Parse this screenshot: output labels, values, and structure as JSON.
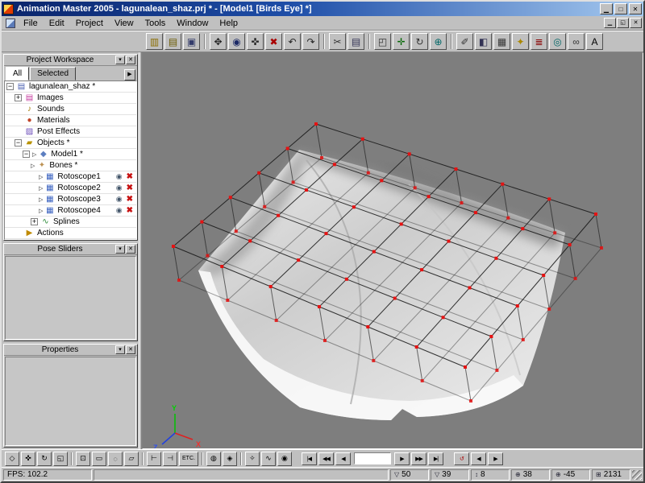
{
  "window": {
    "title": "Animation Master 2005 - lagunalean_shaz.prj * - [Model1 [Birds Eye] *]",
    "controls": [
      {
        "name": "minimize-button",
        "glyph": "▁"
      },
      {
        "name": "maximize-button",
        "glyph": "□"
      },
      {
        "name": "close-button",
        "glyph": "✕"
      }
    ],
    "mdi_controls": [
      {
        "name": "mdi-minimize-button",
        "glyph": "▁"
      },
      {
        "name": "mdi-restore-button",
        "glyph": "◱"
      },
      {
        "name": "mdi-close-button",
        "glyph": "✕"
      }
    ]
  },
  "menus": [
    "File",
    "Edit",
    "Project",
    "View",
    "Tools",
    "Window",
    "Help"
  ],
  "toolbar": {
    "groups": [
      [
        {
          "name": "library-icon",
          "glyph": "▥",
          "color": "#8a6d00"
        },
        {
          "name": "open-project-icon",
          "glyph": "▤",
          "color": "#6b5b00"
        },
        {
          "name": "save-project-icon",
          "glyph": "▣",
          "color": "#343c6b"
        }
      ],
      [
        {
          "name": "pan-icon",
          "glyph": "✥",
          "color": "#222222"
        },
        {
          "name": "zoom-icon",
          "glyph": "◉",
          "color": "#1c2a66"
        },
        {
          "name": "move-icon",
          "glyph": "✜",
          "color": "#222222"
        },
        {
          "name": "delete-icon",
          "glyph": "✖",
          "color": "#aa0000"
        },
        {
          "name": "undo-icon",
          "glyph": "↶",
          "color": "#222222"
        },
        {
          "name": "redo-icon",
          "glyph": "↷",
          "color": "#222222"
        }
      ],
      [
        {
          "name": "cut-icon",
          "glyph": "✂",
          "color": "#333333"
        },
        {
          "name": "copy-icon",
          "glyph": "▤",
          "color": "#333355"
        }
      ],
      [
        {
          "name": "bound-box-icon",
          "glyph": "◰",
          "color": "#333333"
        },
        {
          "name": "translate-manipulator-icon",
          "glyph": "✛",
          "color": "#006600"
        },
        {
          "name": "rotate-manipulator-icon",
          "glyph": "↻",
          "color": "#333333"
        },
        {
          "name": "globe-icon",
          "glyph": "⊕",
          "color": "#006666"
        }
      ],
      [
        {
          "name": "pencil-icon",
          "glyph": "✐",
          "color": "#333333"
        },
        {
          "name": "mirror-mode-icon",
          "glyph": "◧",
          "color": "#333355"
        },
        {
          "name": "grid-icon",
          "glyph": "▦",
          "color": "#333333"
        },
        {
          "name": "key-icon",
          "glyph": "✦",
          "color": "#aa8800"
        },
        {
          "name": "library2-icon",
          "glyph": "≣",
          "color": "#880000"
        },
        {
          "name": "cd-icon",
          "glyph": "◎",
          "color": "#006666"
        },
        {
          "name": "link-icon",
          "glyph": "∞",
          "color": "#333333"
        },
        {
          "name": "font-icon",
          "glyph": "A",
          "color": "#000000"
        }
      ]
    ]
  },
  "workspace": {
    "title": "Project Workspace",
    "header_buttons": [
      {
        "name": "workspace-rollup-button",
        "glyph": "▾"
      },
      {
        "name": "workspace-close-button",
        "glyph": "✕"
      }
    ],
    "tabs": [
      {
        "label": "All",
        "active": true
      },
      {
        "label": "Selected",
        "active": false
      }
    ],
    "tab_scroll": "▶",
    "expander_arrow": "▷",
    "toggle_icons": {
      "eye": "◉",
      "x": "✖"
    },
    "tree_icons": {
      "project": {
        "glyph": "▤",
        "color": "#4a5fb0"
      },
      "images": {
        "glyph": "▤",
        "color": "#c43a9e"
      },
      "sounds": {
        "glyph": "♪",
        "color": "#a07800"
      },
      "materials": {
        "glyph": "●",
        "color": "#c04428"
      },
      "posteffects": {
        "glyph": "▨",
        "color": "#6a4ab8"
      },
      "objects": {
        "glyph": "▰",
        "color": "#b89200"
      },
      "model": {
        "glyph": "◆",
        "color": "#5c7ec0"
      },
      "bones": {
        "glyph": "✦",
        "color": "#bd9355"
      },
      "rotoscope": {
        "glyph": "▦",
        "color": "#3a62c0"
      },
      "splines": {
        "glyph": "∿",
        "color": "#2e8c3a"
      },
      "actions": {
        "glyph": "▶",
        "color": "#c08a00"
      }
    },
    "tree": [
      {
        "label": "lagunalean_shaz *",
        "level": 0,
        "expand": "-",
        "icon": "project"
      },
      {
        "label": "Images",
        "level": 1,
        "expand": "+",
        "icon": "images"
      },
      {
        "label": "Sounds",
        "level": 1,
        "icon": "sounds"
      },
      {
        "label": "Materials",
        "level": 1,
        "icon": "materials"
      },
      {
        "label": "Post Effects",
        "level": 1,
        "icon": "posteffects"
      },
      {
        "label": "Objects *",
        "level": 1,
        "expand": "-",
        "icon": "objects"
      },
      {
        "label": "Model1 *",
        "level": 2,
        "expand": "-",
        "arrow": true,
        "icon": "model"
      },
      {
        "label": "Bones *",
        "level": 3,
        "arrow": true,
        "icon": "bones"
      },
      {
        "label": "Rotoscope1",
        "level": 4,
        "arrow": true,
        "icon": "rotoscope",
        "toggles": true
      },
      {
        "label": "Rotoscope2",
        "level": 4,
        "arrow": true,
        "icon": "rotoscope",
        "toggles": true
      },
      {
        "label": "Rotoscope3",
        "level": 4,
        "arrow": true,
        "icon": "rotoscope",
        "toggles": true
      },
      {
        "label": "Rotoscope4",
        "level": 4,
        "arrow": true,
        "icon": "rotoscope",
        "toggles": true
      },
      {
        "label": "Splines",
        "level": 3,
        "expand": "+",
        "icon": "splines"
      },
      {
        "label": "Actions",
        "level": 1,
        "icon": "actions"
      }
    ]
  },
  "pose_sliders": {
    "title": "Pose Sliders",
    "header_buttons": [
      {
        "name": "pose-rollup-button",
        "glyph": "▾"
      },
      {
        "name": "pose-close-button",
        "glyph": "✕"
      }
    ]
  },
  "properties": {
    "title": "Properties",
    "header_buttons": [
      {
        "name": "properties-rollup-button",
        "glyph": "▾"
      },
      {
        "name": "properties-close-button",
        "glyph": "✕"
      }
    ]
  },
  "viewport": {
    "axis_labels": {
      "x": "X",
      "y": "Y",
      "z": "Z"
    }
  },
  "bottom_toolbar": {
    "groups": [
      [
        {
          "name": "standard-mode-icon",
          "glyph": "◇"
        },
        {
          "name": "translate-mode-icon",
          "glyph": "✜"
        },
        {
          "name": "rotate-mode-icon",
          "glyph": "↻"
        },
        {
          "name": "scale-mode-icon",
          "glyph": "◱"
        }
      ],
      [
        {
          "name": "point-select-icon",
          "glyph": "⊡"
        },
        {
          "name": "group-select-icon",
          "glyph": "▭"
        },
        {
          "name": "lasso-icon",
          "glyph": "◌"
        },
        {
          "name": "patch-select-icon",
          "glyph": "▱"
        }
      ],
      [
        {
          "name": "attach-icon",
          "glyph": "⊢"
        },
        {
          "name": "detach-icon",
          "glyph": "⊣"
        },
        {
          "name": "etc-button",
          "glyph": "ETC.",
          "wide": true
        }
      ],
      [
        {
          "name": "hide-icon",
          "glyph": "◍"
        },
        {
          "name": "lock-icon",
          "glyph": "◈"
        }
      ],
      [
        {
          "name": "bones-mode-icon",
          "glyph": "✧"
        },
        {
          "name": "muscle-mode-icon",
          "glyph": "∿"
        },
        {
          "name": "skin-icon",
          "glyph": "◉"
        }
      ]
    ],
    "playback": {
      "left": [
        {
          "name": "go-to-start-button",
          "glyph": "|◀"
        },
        {
          "name": "prev-key-button",
          "glyph": "◀◀"
        },
        {
          "name": "prev-frame-button",
          "glyph": "◀"
        }
      ],
      "frame_value": "",
      "right": [
        {
          "name": "next-frame-button",
          "glyph": "▶"
        },
        {
          "name": "next-key-button",
          "glyph": "▶▶"
        },
        {
          "name": "go-to-end-button",
          "glyph": "▶|"
        }
      ],
      "extras": [
        {
          "name": "loop-button",
          "glyph": "↺",
          "color": "#aa0000"
        },
        {
          "name": "step-back-button",
          "glyph": "◀"
        },
        {
          "name": "step-forward-button",
          "glyph": "▶"
        }
      ]
    }
  },
  "status_bar": {
    "fps": "FPS: 102.2",
    "cells": [
      {
        "name": "turn-x-indicator",
        "glyph": "▽",
        "value": "50"
      },
      {
        "name": "turn-y-indicator",
        "glyph": "▽",
        "value": "39"
      },
      {
        "name": "zoom-indicator",
        "glyph": "↕",
        "value": "8"
      },
      {
        "name": "rotate-x-indicator",
        "glyph": "⊕",
        "value": "38"
      },
      {
        "name": "rotate-y-indicator",
        "glyph": "⊕",
        "value": "-45"
      },
      {
        "name": "patch-count-indicator",
        "glyph": "⊞",
        "value": "2131"
      }
    ]
  },
  "colors": {
    "titlebar_start": "#0a246a",
    "titlebar_end": "#a6caf0",
    "chrome": "#c0c0c0",
    "viewport_bg": "#7e7e7e",
    "control_point_red": "#e51212"
  }
}
